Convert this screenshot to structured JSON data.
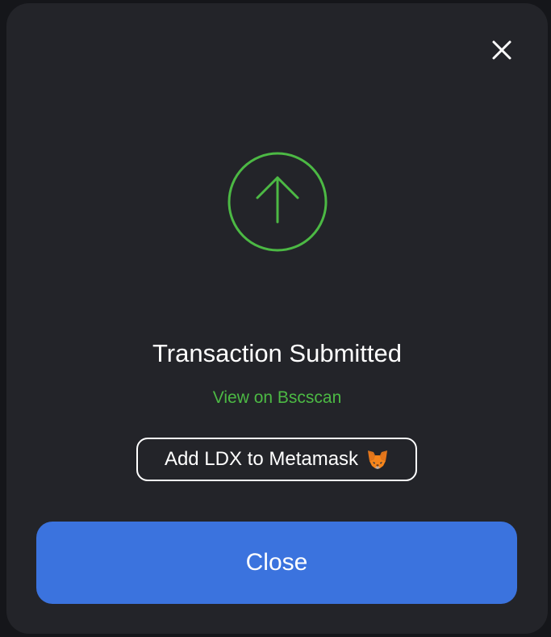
{
  "modal": {
    "title": "Transaction Submitted",
    "explorer_link": "View on Bscscan",
    "add_token_label": "Add LDX to Metamask",
    "close_label": "Close"
  },
  "icons": {
    "dismiss": "close-icon",
    "status": "arrow-up-circle-icon",
    "wallet": "metamask-fox-icon"
  },
  "colors": {
    "modal_bg": "#232429",
    "accent_green": "#4cb944",
    "primary_blue": "#3b73de",
    "text": "#ffffff"
  }
}
